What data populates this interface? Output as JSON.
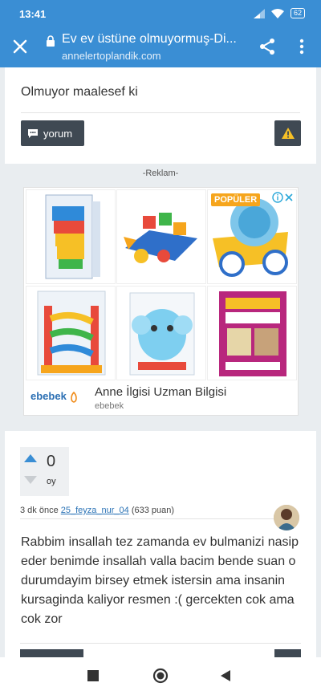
{
  "status": {
    "time": "13:41",
    "battery": "62"
  },
  "browser": {
    "title": "Ev ev üstüne olmuyormuş-Di...",
    "domain": "annelertoplandik.com"
  },
  "post1": {
    "text": "Olmuyor maalesef ki",
    "comment_label": "yorum"
  },
  "ad": {
    "label": "-Reklam-",
    "badge": "POPÜLER",
    "headline": "Anne İlgisi Uzman Bilgisi",
    "advertiser": "ebebek",
    "brand_part1": "ebebek"
  },
  "post2": {
    "votes": "0",
    "votes_label": "oy",
    "time_ago": "3 dk önce",
    "username": "25_feyza_nur_04",
    "points": "(633 puan)",
    "text": "Rabbim insallah tez zamanda ev bulmanizi nasip eder benimde insallah valla bacim bende suan o durumdayim birsey etmek istersin ama insanin kursaginda kaliyor resmen :( gercekten cok ama cok zor"
  },
  "colors": {
    "header": "#3a8ed4",
    "button": "#3f4953",
    "accent_link": "#2b73b6",
    "warning": "#f6c026"
  }
}
